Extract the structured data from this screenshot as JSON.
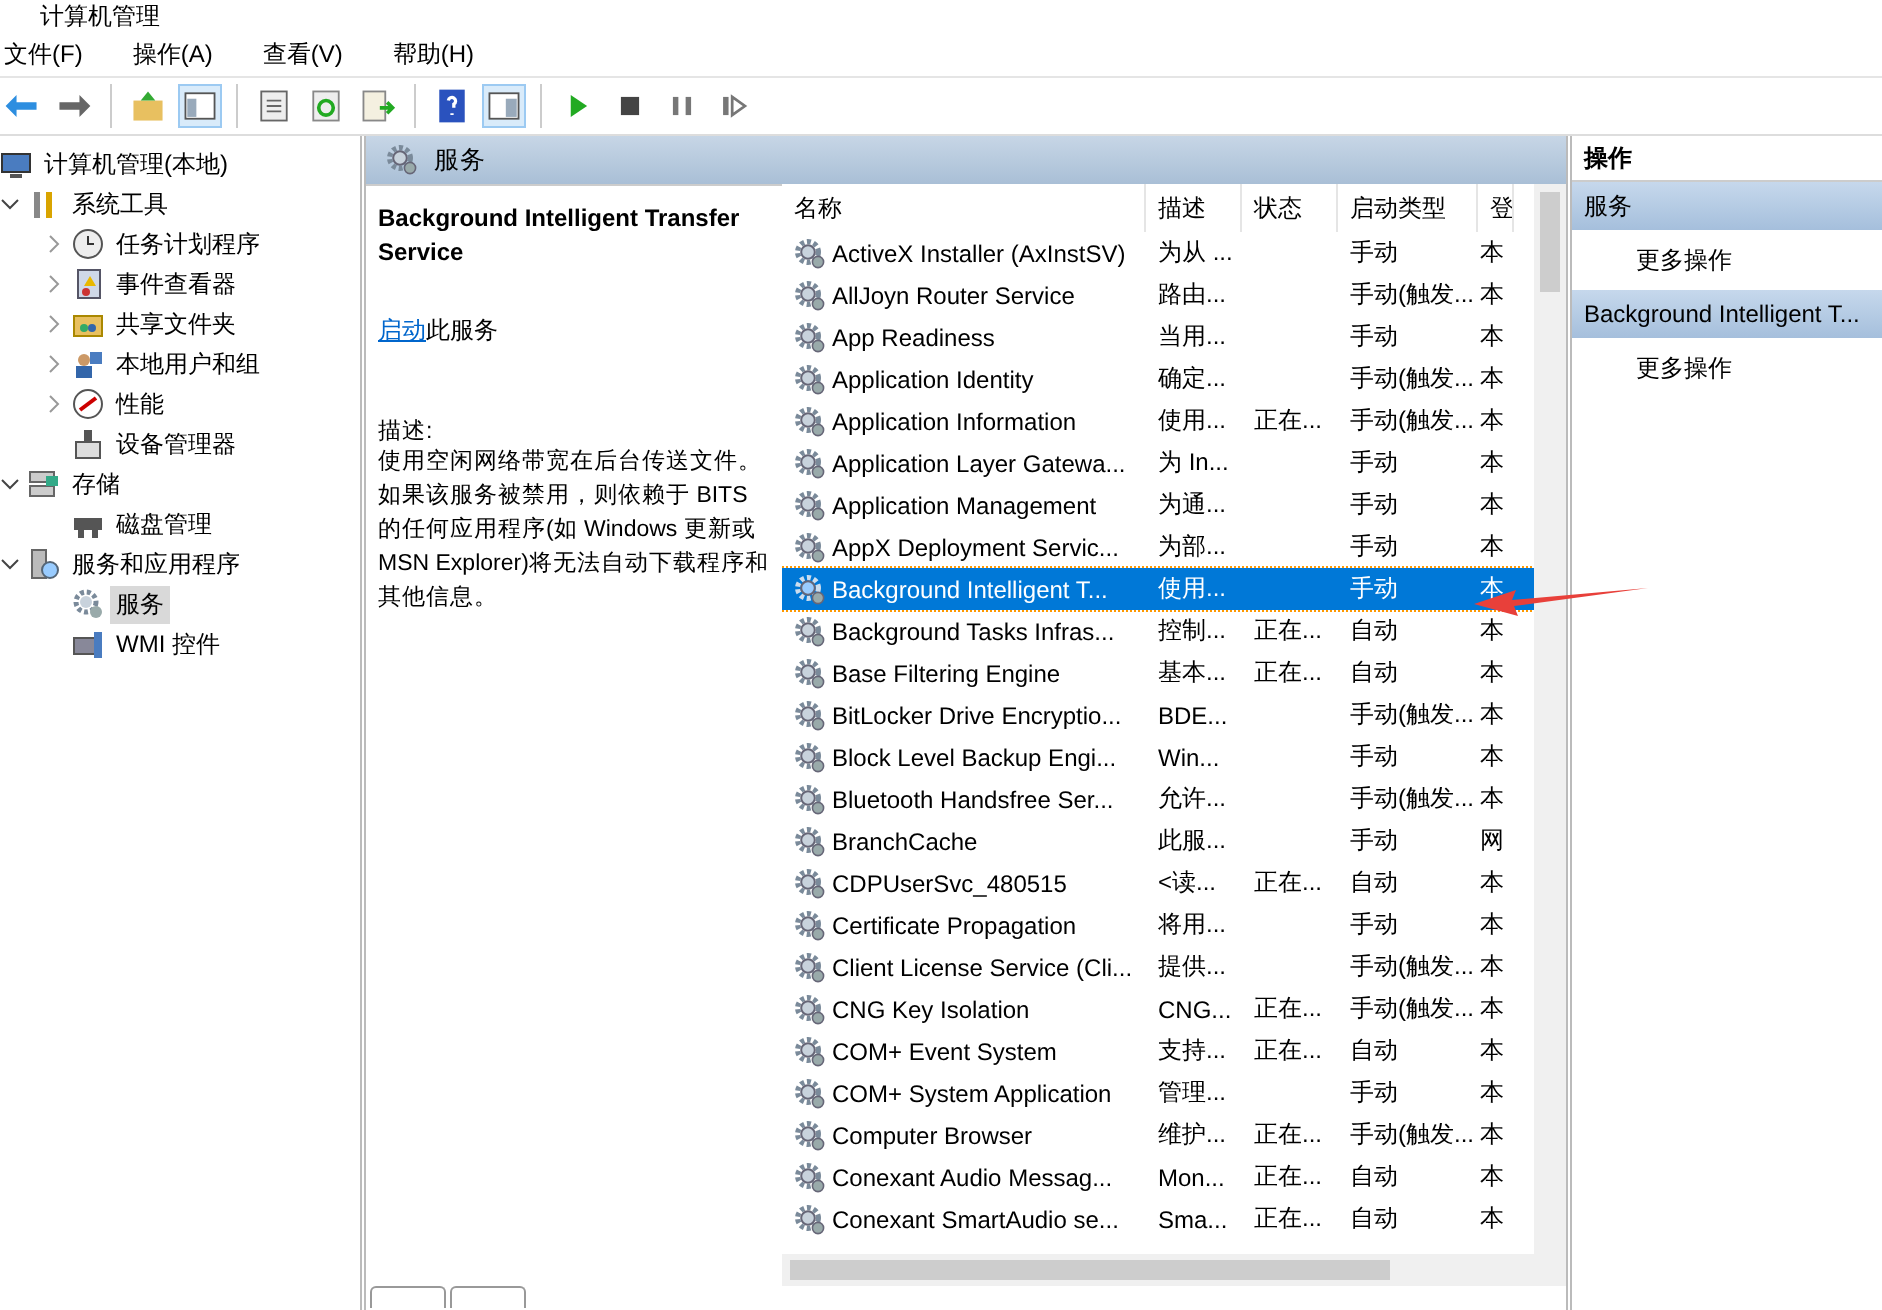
{
  "window": {
    "title": "计算机管理"
  },
  "menu": [
    "文件(F)",
    "操作(A)",
    "查看(V)",
    "帮助(H)"
  ],
  "toolbar": [
    [
      {
        "kind": "back",
        "pressed": false
      },
      {
        "kind": "forward",
        "pressed": false
      }
    ],
    [
      {
        "kind": "up",
        "pressed": false
      },
      {
        "kind": "tree",
        "pressed": true
      }
    ],
    [
      {
        "kind": "props",
        "pressed": false
      },
      {
        "kind": "refresh",
        "pressed": false
      },
      {
        "kind": "export",
        "pressed": false
      }
    ],
    [
      {
        "kind": "help",
        "pressed": false
      },
      {
        "kind": "pane",
        "pressed": true
      }
    ],
    [
      {
        "kind": "play",
        "pressed": false
      },
      {
        "kind": "stop",
        "pressed": false
      },
      {
        "kind": "pause",
        "pressed": false
      },
      {
        "kind": "resume",
        "pressed": false
      }
    ]
  ],
  "tree": [
    {
      "label": "计算机管理(本地)",
      "selected": false,
      "children": [
        {
          "label": "系统工具",
          "expanded": true,
          "selected": false,
          "children": [
            {
              "label": "任务计划程序",
              "expanded": false,
              "selected": false
            },
            {
              "label": "事件查看器",
              "expanded": false,
              "selected": false
            },
            {
              "label": "共享文件夹",
              "expanded": false,
              "selected": false
            },
            {
              "label": "本地用户和组",
              "expanded": false,
              "selected": false
            },
            {
              "label": "性能",
              "expanded": false,
              "selected": false
            },
            {
              "label": "设备管理器",
              "selected": false
            }
          ]
        },
        {
          "label": "存储",
          "expanded": true,
          "selected": false,
          "children": [
            {
              "label": "磁盘管理",
              "selected": false
            }
          ]
        },
        {
          "label": "服务和应用程序",
          "expanded": true,
          "selected": false,
          "children": [
            {
              "label": "服务",
              "selected": true
            },
            {
              "label": "WMI 控件",
              "selected": false
            }
          ]
        }
      ]
    }
  ],
  "pane_header": "服务",
  "details": {
    "title": "Background Intelligent Transfer Service",
    "link": "启动",
    "link_suffix": "此服务",
    "description_label": "描述:",
    "description": "使用空闲网络带宽在后台传送文件。如果该服务被禁用，则依赖于 BITS 的任何应用程序(如 Windows 更新或 MSN Explorer)将无法自动下载程序和其他信息。"
  },
  "table": {
    "columns": [
      "名称",
      "描述",
      "状态",
      "启动类型",
      "登"
    ],
    "rows": [
      {
        "name": "ActiveX Installer (AxInstSV)",
        "description": "为从 ...",
        "status": "",
        "startup": "手动",
        "logon": "本",
        "selected": false
      },
      {
        "name": "AllJoyn Router Service",
        "description": "路由...",
        "status": "",
        "startup": "手动(触发...",
        "logon": "本",
        "selected": false
      },
      {
        "name": "App Readiness",
        "description": "当用...",
        "status": "",
        "startup": "手动",
        "logon": "本",
        "selected": false
      },
      {
        "name": "Application Identity",
        "description": "确定...",
        "status": "",
        "startup": "手动(触发...",
        "logon": "本",
        "selected": false
      },
      {
        "name": "Application Information",
        "description": "使用...",
        "status": "正在...",
        "startup": "手动(触发...",
        "logon": "本",
        "selected": false
      },
      {
        "name": "Application Layer Gatewa...",
        "description": "为 In...",
        "status": "",
        "startup": "手动",
        "logon": "本",
        "selected": false
      },
      {
        "name": "Application Management",
        "description": "为通...",
        "status": "",
        "startup": "手动",
        "logon": "本",
        "selected": false
      },
      {
        "name": "AppX Deployment Servic...",
        "description": "为部...",
        "status": "",
        "startup": "手动",
        "logon": "本",
        "selected": false
      },
      {
        "name": "Background Intelligent T...",
        "description": "使用...",
        "status": "",
        "startup": "手动",
        "logon": "本",
        "selected": true
      },
      {
        "name": "Background Tasks Infras...",
        "description": "控制...",
        "status": "正在...",
        "startup": "自动",
        "logon": "本",
        "selected": false
      },
      {
        "name": "Base Filtering Engine",
        "description": "基本...",
        "status": "正在...",
        "startup": "自动",
        "logon": "本",
        "selected": false
      },
      {
        "name": "BitLocker Drive Encryptio...",
        "description": "BDE...",
        "status": "",
        "startup": "手动(触发...",
        "logon": "本",
        "selected": false
      },
      {
        "name": "Block Level Backup Engi...",
        "description": "Win...",
        "status": "",
        "startup": "手动",
        "logon": "本",
        "selected": false
      },
      {
        "name": "Bluetooth Handsfree Ser...",
        "description": "允许...",
        "status": "",
        "startup": "手动(触发...",
        "logon": "本",
        "selected": false
      },
      {
        "name": "BranchCache",
        "description": "此服...",
        "status": "",
        "startup": "手动",
        "logon": "网",
        "selected": false
      },
      {
        "name": "CDPUserSvc_480515",
        "description": "<读...",
        "status": "正在...",
        "startup": "自动",
        "logon": "本",
        "selected": false
      },
      {
        "name": "Certificate Propagation",
        "description": "将用...",
        "status": "",
        "startup": "手动",
        "logon": "本",
        "selected": false
      },
      {
        "name": "Client License Service (Cli...",
        "description": "提供...",
        "status": "",
        "startup": "手动(触发...",
        "logon": "本",
        "selected": false
      },
      {
        "name": "CNG Key Isolation",
        "description": "CNG...",
        "status": "正在...",
        "startup": "手动(触发...",
        "logon": "本",
        "selected": false
      },
      {
        "name": "COM+ Event System",
        "description": "支持...",
        "status": "正在...",
        "startup": "自动",
        "logon": "本",
        "selected": false
      },
      {
        "name": "COM+ System Application",
        "description": "管理...",
        "status": "",
        "startup": "手动",
        "logon": "本",
        "selected": false
      },
      {
        "name": "Computer Browser",
        "description": "维护...",
        "status": "正在...",
        "startup": "手动(触发...",
        "logon": "本",
        "selected": false
      },
      {
        "name": "Conexant Audio Messag...",
        "description": "Mon...",
        "status": "正在...",
        "startup": "自动",
        "logon": "本",
        "selected": false
      },
      {
        "name": "Conexant SmartAudio se...",
        "description": "Sma...",
        "status": "正在...",
        "startup": "自动",
        "logon": "本",
        "selected": false
      }
    ]
  },
  "actions": {
    "title": "操作",
    "sections": [
      {
        "title": "服务",
        "items": [
          "更多操作"
        ]
      },
      {
        "title": "Background Intelligent T...",
        "items": [
          "更多操作"
        ]
      }
    ]
  }
}
